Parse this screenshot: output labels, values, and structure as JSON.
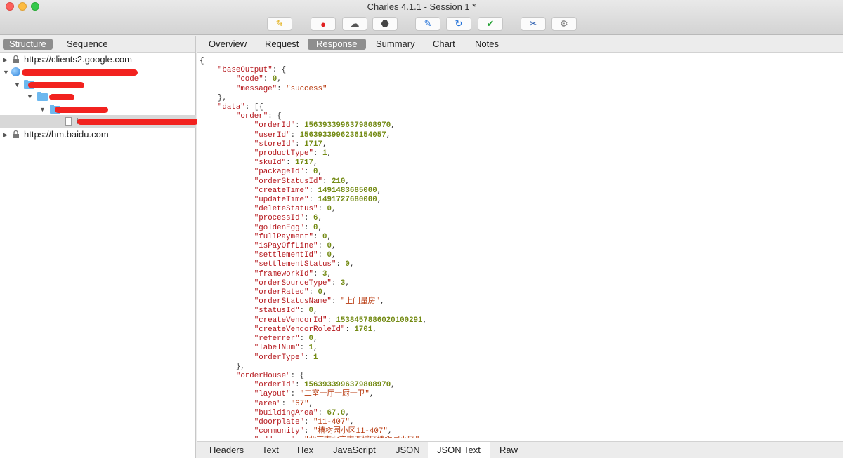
{
  "window": {
    "title": "Charles 4.1.1 - Session 1 *"
  },
  "toolbar": {
    "buttons": [
      {
        "name": "broom",
        "glyph": "✎",
        "color": "#e0a800"
      },
      {
        "name": "record",
        "glyph": "●",
        "color": "#e02020"
      },
      {
        "name": "throttle",
        "glyph": "☁",
        "color": "#555555"
      },
      {
        "name": "breakpoints",
        "glyph": "⬣",
        "color": "#444444"
      },
      {
        "name": "compose",
        "glyph": "✎",
        "color": "#1f6fd8"
      },
      {
        "name": "repeat",
        "glyph": "↻",
        "color": "#1f6fd8"
      },
      {
        "name": "validate",
        "glyph": "✔",
        "color": "#20a030"
      },
      {
        "name": "tools",
        "glyph": "✂",
        "color": "#2a5db0"
      },
      {
        "name": "settings",
        "glyph": "⚙",
        "color": "#888888"
      }
    ]
  },
  "left": {
    "tabs": [
      "Structure",
      "Sequence"
    ],
    "tree": {
      "host1": "https://clients2.google.com",
      "host2": "https://hm.baidu.com",
      "leaf_prefix": "I"
    }
  },
  "right": {
    "tabs": [
      "Overview",
      "Request",
      "Response",
      "Summary",
      "Chart",
      "Notes"
    ],
    "bottom_tabs": [
      "Headers",
      "Text",
      "Hex",
      "JavaScript",
      "JSON",
      "JSON Text",
      "Raw"
    ],
    "code_lines": [
      [
        [
          "p",
          "{"
        ]
      ],
      [
        [
          "p",
          "    "
        ],
        [
          "k",
          "\"baseOutput\""
        ],
        [
          "p",
          ": {"
        ]
      ],
      [
        [
          "p",
          "        "
        ],
        [
          "k",
          "\"code\""
        ],
        [
          "p",
          ": "
        ],
        [
          "n",
          "0"
        ],
        [
          "p",
          ","
        ]
      ],
      [
        [
          "p",
          "        "
        ],
        [
          "k",
          "\"message\""
        ],
        [
          "p",
          ": "
        ],
        [
          "s",
          "\"success\""
        ]
      ],
      [
        [
          "p",
          "    },"
        ]
      ],
      [
        [
          "p",
          "    "
        ],
        [
          "k",
          "\"data\""
        ],
        [
          "p",
          ": [{"
        ]
      ],
      [
        [
          "p",
          "        "
        ],
        [
          "k",
          "\"order\""
        ],
        [
          "p",
          ": {"
        ]
      ],
      [
        [
          "p",
          "            "
        ],
        [
          "k",
          "\"orderId\""
        ],
        [
          "p",
          ": "
        ],
        [
          "n",
          "1563933996379808970"
        ],
        [
          "p",
          ","
        ]
      ],
      [
        [
          "p",
          "            "
        ],
        [
          "k",
          "\"userId\""
        ],
        [
          "p",
          ": "
        ],
        [
          "n",
          "1563933996236154057"
        ],
        [
          "p",
          ","
        ]
      ],
      [
        [
          "p",
          "            "
        ],
        [
          "k",
          "\"storeId\""
        ],
        [
          "p",
          ": "
        ],
        [
          "n",
          "1717"
        ],
        [
          "p",
          ","
        ]
      ],
      [
        [
          "p",
          "            "
        ],
        [
          "k",
          "\"productType\""
        ],
        [
          "p",
          ": "
        ],
        [
          "n",
          "1"
        ],
        [
          "p",
          ","
        ]
      ],
      [
        [
          "p",
          "            "
        ],
        [
          "k",
          "\"skuId\""
        ],
        [
          "p",
          ": "
        ],
        [
          "n",
          "1717"
        ],
        [
          "p",
          ","
        ]
      ],
      [
        [
          "p",
          "            "
        ],
        [
          "k",
          "\"packageId\""
        ],
        [
          "p",
          ": "
        ],
        [
          "n",
          "0"
        ],
        [
          "p",
          ","
        ]
      ],
      [
        [
          "p",
          "            "
        ],
        [
          "k",
          "\"orderStatusId\""
        ],
        [
          "p",
          ": "
        ],
        [
          "n",
          "210"
        ],
        [
          "p",
          ","
        ]
      ],
      [
        [
          "p",
          "            "
        ],
        [
          "k",
          "\"createTime\""
        ],
        [
          "p",
          ": "
        ],
        [
          "n",
          "1491483685000"
        ],
        [
          "p",
          ","
        ]
      ],
      [
        [
          "p",
          "            "
        ],
        [
          "k",
          "\"updateTime\""
        ],
        [
          "p",
          ": "
        ],
        [
          "n",
          "1491727680000"
        ],
        [
          "p",
          ","
        ]
      ],
      [
        [
          "p",
          "            "
        ],
        [
          "k",
          "\"deleteStatus\""
        ],
        [
          "p",
          ": "
        ],
        [
          "n",
          "0"
        ],
        [
          "p",
          ","
        ]
      ],
      [
        [
          "p",
          "            "
        ],
        [
          "k",
          "\"processId\""
        ],
        [
          "p",
          ": "
        ],
        [
          "n",
          "6"
        ],
        [
          "p",
          ","
        ]
      ],
      [
        [
          "p",
          "            "
        ],
        [
          "k",
          "\"goldenEgg\""
        ],
        [
          "p",
          ": "
        ],
        [
          "n",
          "0"
        ],
        [
          "p",
          ","
        ]
      ],
      [
        [
          "p",
          "            "
        ],
        [
          "k",
          "\"fullPayment\""
        ],
        [
          "p",
          ": "
        ],
        [
          "n",
          "0"
        ],
        [
          "p",
          ","
        ]
      ],
      [
        [
          "p",
          "            "
        ],
        [
          "k",
          "\"isPayOffLine\""
        ],
        [
          "p",
          ": "
        ],
        [
          "n",
          "0"
        ],
        [
          "p",
          ","
        ]
      ],
      [
        [
          "p",
          "            "
        ],
        [
          "k",
          "\"settlementId\""
        ],
        [
          "p",
          ": "
        ],
        [
          "n",
          "0"
        ],
        [
          "p",
          ","
        ]
      ],
      [
        [
          "p",
          "            "
        ],
        [
          "k",
          "\"settlementStatus\""
        ],
        [
          "p",
          ": "
        ],
        [
          "n",
          "0"
        ],
        [
          "p",
          ","
        ]
      ],
      [
        [
          "p",
          "            "
        ],
        [
          "k",
          "\"frameworkId\""
        ],
        [
          "p",
          ": "
        ],
        [
          "n",
          "3"
        ],
        [
          "p",
          ","
        ]
      ],
      [
        [
          "p",
          "            "
        ],
        [
          "k",
          "\"orderSourceType\""
        ],
        [
          "p",
          ": "
        ],
        [
          "n",
          "3"
        ],
        [
          "p",
          ","
        ]
      ],
      [
        [
          "p",
          "            "
        ],
        [
          "k",
          "\"orderRated\""
        ],
        [
          "p",
          ": "
        ],
        [
          "n",
          "0"
        ],
        [
          "p",
          ","
        ]
      ],
      [
        [
          "p",
          "            "
        ],
        [
          "k",
          "\"orderStatusName\""
        ],
        [
          "p",
          ": "
        ],
        [
          "s",
          "\"上门量房\""
        ],
        [
          "p",
          ","
        ]
      ],
      [
        [
          "p",
          "            "
        ],
        [
          "k",
          "\"statusId\""
        ],
        [
          "p",
          ": "
        ],
        [
          "n",
          "0"
        ],
        [
          "p",
          ","
        ]
      ],
      [
        [
          "p",
          "            "
        ],
        [
          "k",
          "\"createVendorId\""
        ],
        [
          "p",
          ": "
        ],
        [
          "n",
          "1538457886020100291"
        ],
        [
          "p",
          ","
        ]
      ],
      [
        [
          "p",
          "            "
        ],
        [
          "k",
          "\"createVendorRoleId\""
        ],
        [
          "p",
          ": "
        ],
        [
          "n",
          "1701"
        ],
        [
          "p",
          ","
        ]
      ],
      [
        [
          "p",
          "            "
        ],
        [
          "k",
          "\"referrer\""
        ],
        [
          "p",
          ": "
        ],
        [
          "n",
          "0"
        ],
        [
          "p",
          ","
        ]
      ],
      [
        [
          "p",
          "            "
        ],
        [
          "k",
          "\"labelNum\""
        ],
        [
          "p",
          ": "
        ],
        [
          "n",
          "1"
        ],
        [
          "p",
          ","
        ]
      ],
      [
        [
          "p",
          "            "
        ],
        [
          "k",
          "\"orderType\""
        ],
        [
          "p",
          ": "
        ],
        [
          "n",
          "1"
        ]
      ],
      [
        [
          "p",
          "        },"
        ]
      ],
      [
        [
          "p",
          "        "
        ],
        [
          "k",
          "\"orderHouse\""
        ],
        [
          "p",
          ": {"
        ]
      ],
      [
        [
          "p",
          "            "
        ],
        [
          "k",
          "\"orderId\""
        ],
        [
          "p",
          ": "
        ],
        [
          "n",
          "1563933996379808970"
        ],
        [
          "p",
          ","
        ]
      ],
      [
        [
          "p",
          "            "
        ],
        [
          "k",
          "\"layout\""
        ],
        [
          "p",
          ": "
        ],
        [
          "s",
          "\"二室一厅一厨一卫\""
        ],
        [
          "p",
          ","
        ]
      ],
      [
        [
          "p",
          "            "
        ],
        [
          "k",
          "\"area\""
        ],
        [
          "p",
          ": "
        ],
        [
          "s",
          "\"67\""
        ],
        [
          "p",
          ","
        ]
      ],
      [
        [
          "p",
          "            "
        ],
        [
          "k",
          "\"buildingArea\""
        ],
        [
          "p",
          ": "
        ],
        [
          "n",
          "67.0"
        ],
        [
          "p",
          ","
        ]
      ],
      [
        [
          "p",
          "            "
        ],
        [
          "k",
          "\"doorplate\""
        ],
        [
          "p",
          ": "
        ],
        [
          "s",
          "\"11-407\""
        ],
        [
          "p",
          ","
        ]
      ],
      [
        [
          "p",
          "            "
        ],
        [
          "k",
          "\"community\""
        ],
        [
          "p",
          ": "
        ],
        [
          "s",
          "\"椿树园小区11-407\""
        ],
        [
          "p",
          ","
        ]
      ],
      [
        [
          "p",
          "            "
        ],
        [
          "k",
          "\"address\""
        ],
        [
          "p",
          ": "
        ],
        [
          "s",
          "\"北京市北京市西城区椿树园小区\""
        ],
        [
          "p",
          ","
        ]
      ]
    ]
  }
}
